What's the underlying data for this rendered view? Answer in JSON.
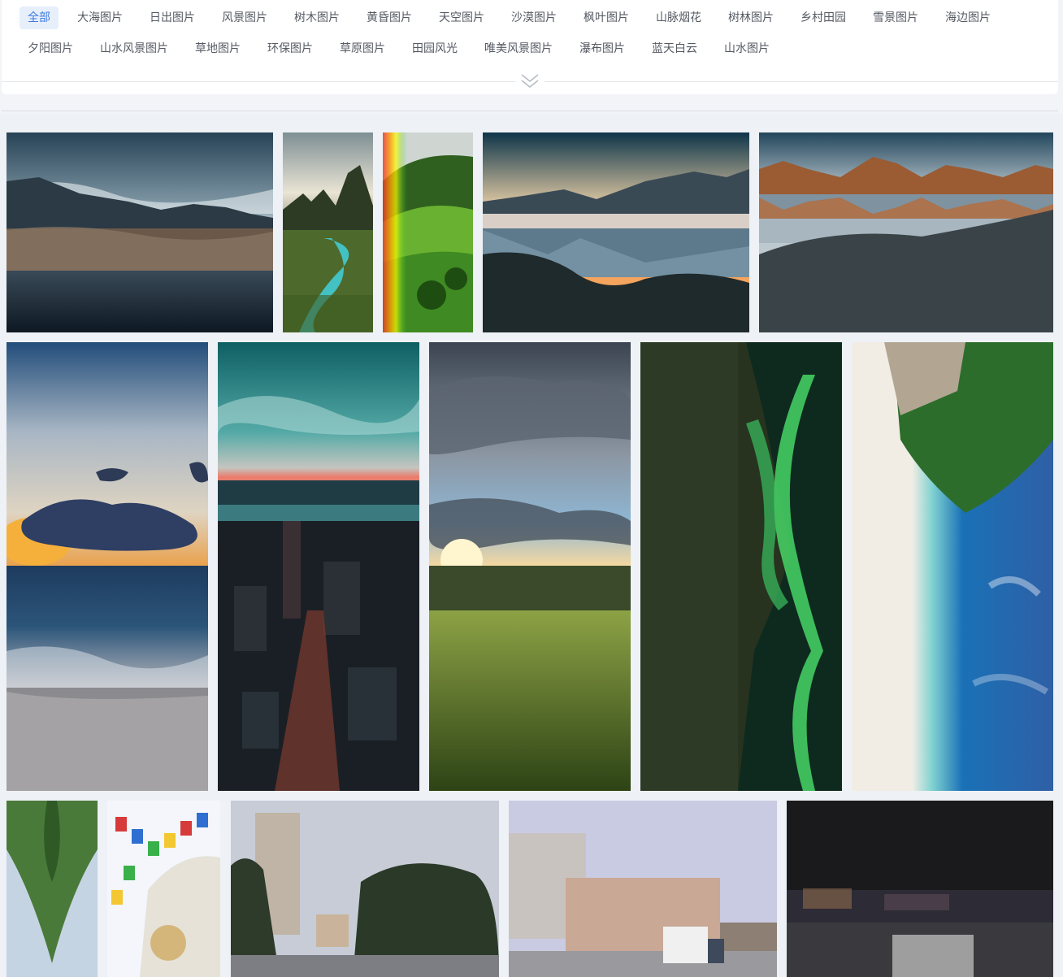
{
  "categories": [
    {
      "label": "全部",
      "active": true
    },
    {
      "label": "大海图片"
    },
    {
      "label": "日出图片"
    },
    {
      "label": "风景图片"
    },
    {
      "label": "树木图片"
    },
    {
      "label": "黄昏图片"
    },
    {
      "label": "天空图片"
    },
    {
      "label": "沙漠图片"
    },
    {
      "label": "枫叶图片"
    },
    {
      "label": "山脉烟花"
    },
    {
      "label": "树林图片"
    },
    {
      "label": "乡村田园"
    },
    {
      "label": "雪景图片"
    },
    {
      "label": "海边图片"
    },
    {
      "label": "夕阳图片"
    },
    {
      "label": "山水风景图片"
    },
    {
      "label": "草地图片"
    },
    {
      "label": "环保图片"
    },
    {
      "label": "草原图片"
    },
    {
      "label": "田园风光"
    },
    {
      "label": "唯美风景图片"
    },
    {
      "label": "瀑布图片"
    },
    {
      "label": "蓝天白云"
    },
    {
      "label": "山水图片"
    }
  ],
  "expand_icon": "double-chevron-down-icon",
  "colors": {
    "active_tag_bg": "#e7effb",
    "active_tag_text": "#3d7be0",
    "tag_text": "#555a63",
    "page_bg": "#f2f4f7"
  },
  "gallery": {
    "images": [
      {
        "name": "lake-reeds-mountains-photo"
      },
      {
        "name": "river-valley-peaks-photo"
      },
      {
        "name": "rainbow-green-hills-photo"
      },
      {
        "name": "mountain-lake-reflection-photo"
      },
      {
        "name": "orange-peaks-reflection-photo"
      },
      {
        "name": "ocean-sunset-clouds-photo"
      },
      {
        "name": "city-aerial-dusk-photo"
      },
      {
        "name": "wheat-field-sunburst-photo"
      },
      {
        "name": "aurora-mountain-photo"
      },
      {
        "name": "tropical-beach-rotated-photo"
      },
      {
        "name": "mirrored-forest-photo"
      },
      {
        "name": "prayer-flags-stupa-photo"
      },
      {
        "name": "tower-trees-street-photo"
      },
      {
        "name": "building-street-truck-photo"
      },
      {
        "name": "city-night-skyline-photo"
      }
    ]
  }
}
